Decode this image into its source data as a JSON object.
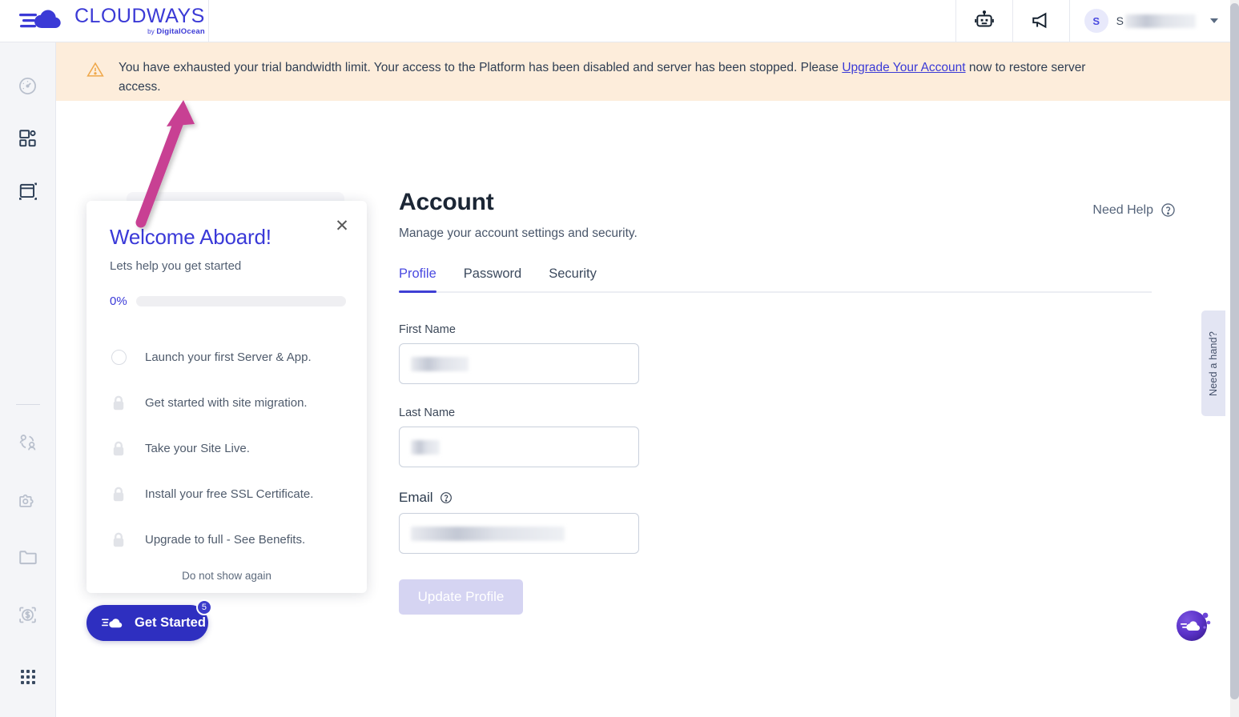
{
  "brand": {
    "name": "CLOUDWAYS",
    "by": "by ",
    "parent": "DigitalOcean"
  },
  "topbar": {
    "bot_icon": "robot-icon",
    "announcement_icon": "megaphone-icon",
    "user_initial": "S",
    "user_name_visible": "S",
    "chevron": "chevron-down-icon"
  },
  "sidebar": {
    "items": [
      {
        "name": "dashboard",
        "icon": "gauge-icon"
      },
      {
        "name": "servers",
        "icon": "servers-icon"
      },
      {
        "name": "applications",
        "icon": "application-window-icon"
      },
      {
        "name": "team",
        "icon": "team-users-icon"
      },
      {
        "name": "addons",
        "icon": "addon-puzzle-icon"
      },
      {
        "name": "projects",
        "icon": "folder-icon"
      },
      {
        "name": "billing",
        "icon": "dollar-circle-icon"
      },
      {
        "name": "apps-grid",
        "icon": "grid-apps-icon"
      }
    ]
  },
  "alert": {
    "icon": "warning-triangle-icon",
    "text_before": "You have exhausted your trial bandwidth limit. Your access to the Platform has been disabled and server has been stopped. Please ",
    "link": "Upgrade Your Account",
    "text_after": " now to restore server access."
  },
  "page": {
    "title": "Account",
    "subtitle": "Manage your account settings and security.",
    "need_help": "Need Help",
    "need_help_icon": "question-circle-icon"
  },
  "tabs": [
    {
      "label": "Profile",
      "active": true
    },
    {
      "label": "Password",
      "active": false
    },
    {
      "label": "Security",
      "active": false
    }
  ],
  "form": {
    "first_name_label": "First Name",
    "first_name_value": "",
    "last_name_label": "Last Name",
    "last_name_value": "",
    "email_label": "Email",
    "email_help_icon": "question-circle-icon",
    "email_value": "",
    "submit_label": "Update Profile"
  },
  "modal": {
    "close_icon": "close-icon",
    "title": "Welcome Aboard!",
    "subtitle": "Lets help you get started",
    "progress_percent": "0%",
    "progress_value": 0,
    "steps": [
      {
        "label": "Launch your first Server & App.",
        "icon": "empty-circle-icon",
        "locked": false
      },
      {
        "label": "Get started with site migration.",
        "icon": "lock-icon",
        "locked": true
      },
      {
        "label": "Take your Site Live.",
        "icon": "lock-icon",
        "locked": true
      },
      {
        "label": "Install your free SSL Certificate.",
        "icon": "lock-icon",
        "locked": true
      },
      {
        "label": "Upgrade to full - See Benefits.",
        "icon": "lock-icon",
        "locked": true
      }
    ],
    "dismiss_label": "Do not show again"
  },
  "get_started": {
    "label": "Get Started",
    "badge": "5",
    "icon": "cloudways-cloud-icon"
  },
  "right_rail": {
    "need_hand_label": "Need a hand?",
    "chat_icon": "cloudways-chat-icon"
  },
  "colors": {
    "brand_blue": "#3b3ad6",
    "alert_bg": "#fdeddb",
    "accent": "#4a4ae0",
    "annotation_pink": "#c44193"
  }
}
